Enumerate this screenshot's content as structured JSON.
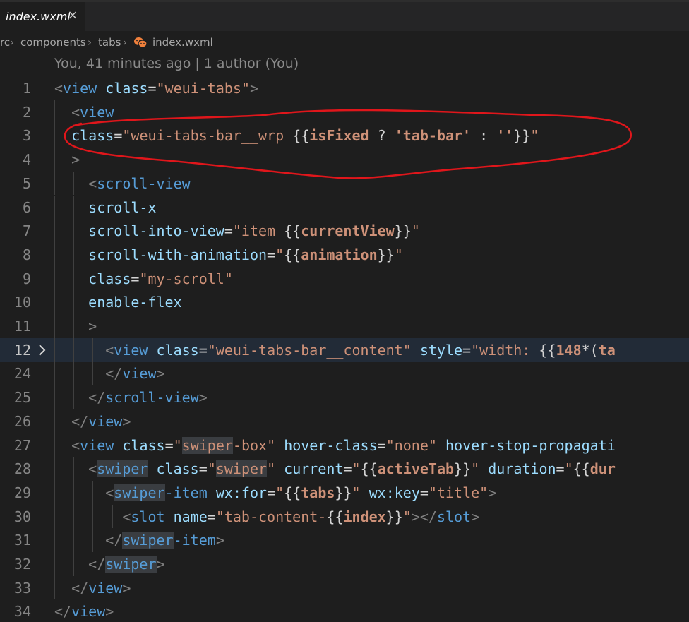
{
  "tab": {
    "title": "index.wxml",
    "close_icon": "×"
  },
  "breadcrumb": {
    "items": [
      "rc",
      "components",
      "tabs",
      "index.wxml"
    ],
    "file_icon": "wechat-icon"
  },
  "blame": "You, 41 minutes ago | 1 author (You)",
  "lines": [
    {
      "n": "1",
      "segs": [
        [
          "br",
          "<"
        ],
        [
          "tag",
          "view"
        ],
        [
          "sp",
          " "
        ],
        [
          "attr",
          "class"
        ],
        [
          "eq",
          "="
        ],
        [
          "str",
          "\"weui-tabs\""
        ],
        [
          "br",
          ">"
        ]
      ]
    },
    {
      "n": "2",
      "segs": [
        [
          "sp",
          "  "
        ],
        [
          "br",
          "<"
        ],
        [
          "tag",
          "view"
        ]
      ]
    },
    {
      "n": "3",
      "segs": [
        [
          "sp",
          "  "
        ],
        [
          "attr",
          "class"
        ],
        [
          "eq",
          "="
        ],
        [
          "str",
          "\"weui-tabs-bar__wrp "
        ],
        [
          "brace",
          "{{"
        ],
        [
          "bold",
          "isFixed"
        ],
        [
          "pun",
          " ? "
        ],
        [
          "bold",
          "'tab-bar'"
        ],
        [
          "pun",
          " : "
        ],
        [
          "bold",
          "''"
        ],
        [
          "brace",
          "}}"
        ],
        [
          "str",
          "\""
        ]
      ]
    },
    {
      "n": "4",
      "segs": [
        [
          "sp",
          "  "
        ],
        [
          "br",
          ">"
        ]
      ]
    },
    {
      "n": "5",
      "segs": [
        [
          "sp",
          "    "
        ],
        [
          "br",
          "<"
        ],
        [
          "tag",
          "scroll-view"
        ]
      ]
    },
    {
      "n": "6",
      "segs": [
        [
          "sp",
          "    "
        ],
        [
          "attr",
          "scroll-x"
        ]
      ]
    },
    {
      "n": "7",
      "segs": [
        [
          "sp",
          "    "
        ],
        [
          "attr",
          "scroll-into-view"
        ],
        [
          "eq",
          "="
        ],
        [
          "str",
          "\"item_"
        ],
        [
          "brace",
          "{{"
        ],
        [
          "bold",
          "currentView"
        ],
        [
          "brace",
          "}}"
        ],
        [
          "str",
          "\""
        ]
      ]
    },
    {
      "n": "8",
      "segs": [
        [
          "sp",
          "    "
        ],
        [
          "attr",
          "scroll-with-animation"
        ],
        [
          "eq",
          "="
        ],
        [
          "str",
          "\""
        ],
        [
          "brace",
          "{{"
        ],
        [
          "bold",
          "animation"
        ],
        [
          "brace",
          "}}"
        ],
        [
          "str",
          "\""
        ]
      ]
    },
    {
      "n": "9",
      "segs": [
        [
          "sp",
          "    "
        ],
        [
          "attr",
          "class"
        ],
        [
          "eq",
          "="
        ],
        [
          "str",
          "\"my-scroll\""
        ]
      ]
    },
    {
      "n": "10",
      "segs": [
        [
          "sp",
          "    "
        ],
        [
          "attr",
          "enable-flex"
        ]
      ]
    },
    {
      "n": "11",
      "segs": [
        [
          "sp",
          "    "
        ],
        [
          "br",
          ">"
        ]
      ]
    },
    {
      "n": "12",
      "current": true,
      "folded": true,
      "segs": [
        [
          "sp",
          "      "
        ],
        [
          "br",
          "<"
        ],
        [
          "tag",
          "view"
        ],
        [
          "sp",
          " "
        ],
        [
          "attr",
          "class"
        ],
        [
          "eq",
          "="
        ],
        [
          "str",
          "\"weui-tabs-bar__content\""
        ],
        [
          "sp",
          " "
        ],
        [
          "attr",
          "style"
        ],
        [
          "eq",
          "="
        ],
        [
          "str",
          "\"width: "
        ],
        [
          "brace",
          "{{"
        ],
        [
          "bold",
          "148"
        ],
        [
          "pun",
          "*("
        ],
        [
          "bold",
          "ta"
        ]
      ]
    },
    {
      "n": "24",
      "segs": [
        [
          "sp",
          "      "
        ],
        [
          "br",
          "</"
        ],
        [
          "tag",
          "view"
        ],
        [
          "br",
          ">"
        ]
      ]
    },
    {
      "n": "25",
      "segs": [
        [
          "sp",
          "    "
        ],
        [
          "br",
          "</"
        ],
        [
          "tag",
          "scroll-view"
        ],
        [
          "br",
          ">"
        ]
      ]
    },
    {
      "n": "26",
      "segs": [
        [
          "sp",
          "  "
        ],
        [
          "br",
          "</"
        ],
        [
          "tag",
          "view"
        ],
        [
          "br",
          ">"
        ]
      ]
    },
    {
      "n": "27",
      "segs": [
        [
          "sp",
          "  "
        ],
        [
          "br",
          "<"
        ],
        [
          "tag",
          "view"
        ],
        [
          "sp",
          " "
        ],
        [
          "attr",
          "class"
        ],
        [
          "eq",
          "="
        ],
        [
          "str",
          "\""
        ],
        [
          "str-hl",
          "swiper"
        ],
        [
          "str",
          "-box\""
        ],
        [
          "sp",
          " "
        ],
        [
          "attr",
          "hover-class"
        ],
        [
          "eq",
          "="
        ],
        [
          "str",
          "\"none\""
        ],
        [
          "sp",
          " "
        ],
        [
          "attr",
          "hover-stop-propagati"
        ]
      ]
    },
    {
      "n": "28",
      "segs": [
        [
          "sp",
          "    "
        ],
        [
          "br",
          "<"
        ],
        [
          "tag-hl",
          "swiper"
        ],
        [
          "sp",
          " "
        ],
        [
          "attr",
          "class"
        ],
        [
          "eq",
          "="
        ],
        [
          "str",
          "\""
        ],
        [
          "str-hl",
          "swiper"
        ],
        [
          "str",
          "\""
        ],
        [
          "sp",
          " "
        ],
        [
          "attr",
          "current"
        ],
        [
          "eq",
          "="
        ],
        [
          "str",
          "\""
        ],
        [
          "brace",
          "{{"
        ],
        [
          "bold",
          "activeTab"
        ],
        [
          "brace",
          "}}"
        ],
        [
          "str",
          "\""
        ],
        [
          "sp",
          " "
        ],
        [
          "attr",
          "duration"
        ],
        [
          "eq",
          "="
        ],
        [
          "str",
          "\""
        ],
        [
          "brace",
          "{{"
        ],
        [
          "bold",
          "dur"
        ]
      ]
    },
    {
      "n": "29",
      "segs": [
        [
          "sp",
          "      "
        ],
        [
          "br",
          "<"
        ],
        [
          "tag-hl",
          "swiper"
        ],
        [
          "tag",
          "-item"
        ],
        [
          "sp",
          " "
        ],
        [
          "attr",
          "wx:for"
        ],
        [
          "eq",
          "="
        ],
        [
          "str",
          "\""
        ],
        [
          "brace",
          "{{"
        ],
        [
          "bold",
          "tabs"
        ],
        [
          "brace",
          "}}"
        ],
        [
          "str",
          "\""
        ],
        [
          "sp",
          " "
        ],
        [
          "attr",
          "wx:key"
        ],
        [
          "eq",
          "="
        ],
        [
          "str",
          "\"title\""
        ],
        [
          "br",
          ">"
        ]
      ]
    },
    {
      "n": "30",
      "segs": [
        [
          "sp",
          "        "
        ],
        [
          "br",
          "<"
        ],
        [
          "tag",
          "slot"
        ],
        [
          "sp",
          " "
        ],
        [
          "attr",
          "name"
        ],
        [
          "eq",
          "="
        ],
        [
          "str",
          "\"tab-content-"
        ],
        [
          "brace",
          "{{"
        ],
        [
          "bold",
          "index"
        ],
        [
          "brace",
          "}}"
        ],
        [
          "str",
          "\""
        ],
        [
          "br",
          "></"
        ],
        [
          "tag",
          "slot"
        ],
        [
          "br",
          ">"
        ]
      ]
    },
    {
      "n": "31",
      "segs": [
        [
          "sp",
          "      "
        ],
        [
          "br",
          "</"
        ],
        [
          "tag-hl",
          "swiper"
        ],
        [
          "tag",
          "-item"
        ],
        [
          "br",
          ">"
        ]
      ]
    },
    {
      "n": "32",
      "segs": [
        [
          "sp",
          "    "
        ],
        [
          "br",
          "</"
        ],
        [
          "tag-hl",
          "swiper"
        ],
        [
          "br",
          ">"
        ]
      ]
    },
    {
      "n": "33",
      "segs": [
        [
          "sp",
          "  "
        ],
        [
          "br",
          "</"
        ],
        [
          "tag",
          "view"
        ],
        [
          "br",
          ">"
        ]
      ]
    },
    {
      "n": "34",
      "segs": [
        [
          "br",
          "</"
        ],
        [
          "tag",
          "view"
        ],
        [
          "br",
          ">"
        ]
      ]
    }
  ],
  "annotation": {
    "type": "red-freehand-ellipse",
    "color": "#e0161b",
    "encircles_line": "3"
  }
}
